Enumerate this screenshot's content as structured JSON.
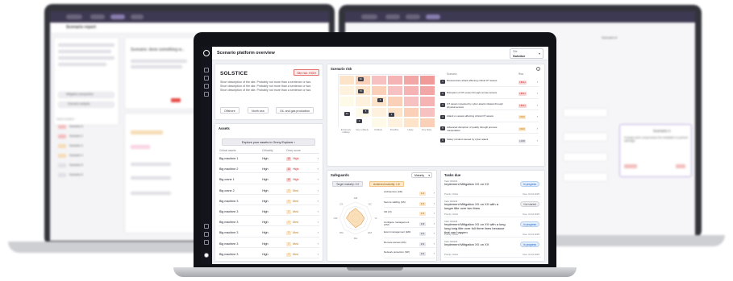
{
  "header": {
    "title": "Scenario platform overview",
    "site_label": "Site",
    "site_value": "Solstice"
  },
  "solstice": {
    "title": "SOLSTICE",
    "risk_badge": "Site risk: HIGH",
    "description": "Short description of the site. Probably not more than a sentence or two. Short description of the site. Probably not more than a sentence or two. Short description of the site. Probably not more than a sentence or two.",
    "tags": [
      "Offshore",
      "North sea",
      "Oil- and gas production"
    ]
  },
  "assets": {
    "title": "Assets",
    "explore_label": "Explore your assets in Omny Explorer",
    "columns": [
      "Critical assets",
      "Criticality",
      "Omny score"
    ],
    "rows": [
      {
        "name": "Big machine 1",
        "criticality": "High",
        "score": "10",
        "level": "High"
      },
      {
        "name": "Big machine 2",
        "criticality": "High",
        "score": "10",
        "level": "High"
      },
      {
        "name": "Big crane 1",
        "criticality": "High",
        "score": "10",
        "level": "High"
      },
      {
        "name": "Big crane 2",
        "criticality": "High",
        "score": "7",
        "level": "Med"
      },
      {
        "name": "Big machine 3",
        "criticality": "High",
        "score": "7",
        "level": "Med"
      },
      {
        "name": "Big machine 3",
        "criticality": "High",
        "score": "7",
        "level": "Med"
      },
      {
        "name": "Big machine 3",
        "criticality": "High",
        "score": "7",
        "level": "Med"
      },
      {
        "name": "Big machine 3",
        "criticality": "High",
        "score": "7",
        "level": "Med"
      },
      {
        "name": "Big machine 3",
        "criticality": "High",
        "score": "7",
        "level": "Med"
      },
      {
        "name": "Big machine 3",
        "criticality": "High",
        "score": "7",
        "level": "Med"
      }
    ]
  },
  "scenario_risk": {
    "title": "Scenario risk",
    "x_labels": [
      "Extremely unlikely",
      "Very unlikely",
      "Unlikely",
      "Possible",
      "Likely",
      "Very likely"
    ],
    "col_headers": [
      "Scenario",
      "Risk"
    ],
    "chips": [
      "9C",
      "7C",
      "6",
      "5",
      "1C",
      "2",
      "1"
    ],
    "scenarios": [
      {
        "num": "1",
        "text": "Ransomware attack affecting critical OT assets",
        "risk": "HIGH"
      },
      {
        "num": "2",
        "text": "Disruption of OT power through remote access",
        "risk": "HIGH"
      },
      {
        "num": "3",
        "text": "OT assets impacted by cyber attack initiated through physical access",
        "risk": "HIGH"
      },
      {
        "num": "4",
        "text": "Attack on assets affecting critical OT assets",
        "risk": "MED"
      },
      {
        "num": "5",
        "text": "Advanced disruption of quality through process manipulation",
        "risk": "MED"
      },
      {
        "num": "6",
        "text": "Safety incident caused by cyber attack",
        "risk": "LOW"
      }
    ]
  },
  "safeguards": {
    "title": "Safeguards",
    "select_label": "Maturity",
    "target_label": "Target maturity: 2.0",
    "achieved_label": "Achieved maturity: 1.8",
    "radar_labels": [
      "AM",
      "SC",
      "VI",
      "EM",
      "RA",
      "NM",
      "CM",
      "CS"
    ],
    "rows": [
      {
        "name": "Architecture (AR)",
        "value": "1.2"
      },
      {
        "name": "Secure staffing (SS)",
        "value": "1.5"
      },
      {
        "name": "Vill (VI)",
        "value": "1.5"
      },
      {
        "name": "Configure management (CM)",
        "value": "1.8"
      },
      {
        "name": "Event management (EM)",
        "value": "2.2"
      },
      {
        "name": "Remote access (RA)",
        "value": "2.3"
      },
      {
        "name": "Network protection (NP)",
        "value": "2.3"
      }
    ]
  },
  "tasks": {
    "title": "Tasks due",
    "items": [
      {
        "id": "Task 000234",
        "name": "Implement Mitigation XX on XX",
        "priority": "Priority: HIGH",
        "status": "In progress",
        "date": "Due: 31.10.2025"
      },
      {
        "id": "Task 000234",
        "name": "Implement Mitigation XX on XX with a longer title over two lines",
        "priority": "Priority: HIGH",
        "status": "Not started",
        "date": "Due: 31.10.2025"
      },
      {
        "id": "Task 000234",
        "name": "Implement Mitigation XX on XX with a long long long title over full three lines because that can happen",
        "priority": "Priority: HIGH",
        "status": "In progress",
        "date": "Due: 31.10.2025"
      },
      {
        "id": "Task 000234",
        "name": "Implement Mitigation XX on XX",
        "priority": "Priority: HIGH",
        "status": "In progress",
        "date": "Due: 31.10.2025"
      }
    ]
  },
  "bg_left": {
    "title": "Scenario report",
    "heading": "Scenario: done something w...",
    "button1": "Mitigation perspective",
    "button2": "Scenario analysis",
    "list_header": "Stock incident",
    "items": [
      "Scenario A",
      "Scenario 2",
      "Scenario 3",
      "Scenario 4",
      "Scenario 5",
      "Scenario 6"
    ]
  },
  "bg_right": {
    "title": "Scenario A",
    "node_label": "Scenario A",
    "detail": "A (large) actor compromises the installation to perform sabotage"
  },
  "colors": {
    "accent": "#2a2440",
    "high": "#c62828",
    "med": "#c77700",
    "rail": "#14151c"
  }
}
